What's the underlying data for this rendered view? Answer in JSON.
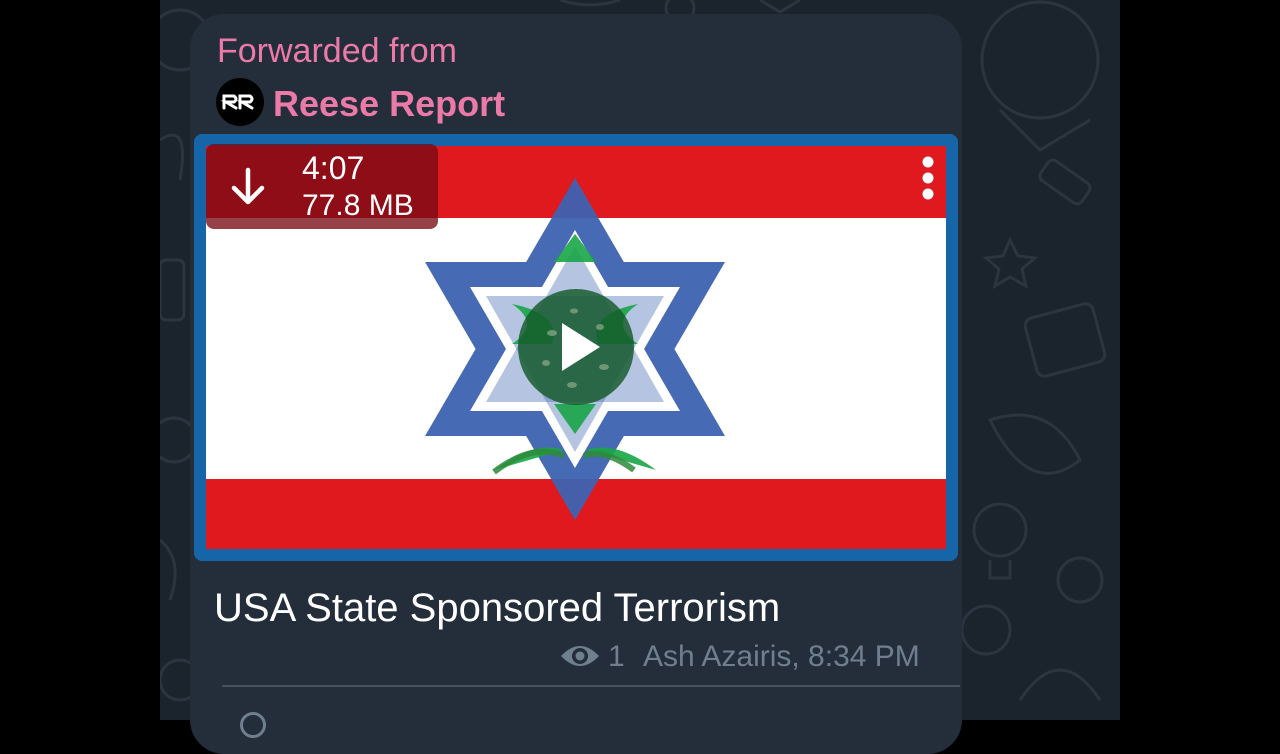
{
  "message": {
    "forwarded_label": "Forwarded from",
    "channel_name": "Reese Report",
    "avatar_initials": "RR",
    "video": {
      "duration": "4:07",
      "file_size": "77.8 MB",
      "download_icon": "arrow-down-icon",
      "menu_icon": "more-vertical-icon",
      "play_icon": "play-icon"
    },
    "caption": "USA State Sponsored Terrorism",
    "views": "1",
    "meta_text": "Ash Azairis, 8:34 PM",
    "eye_icon": "eye-icon"
  },
  "colors": {
    "forward_accent": "#ec7aa8",
    "bubble": "#242e3a",
    "chat_background": "#1b232c",
    "meta_text": "#6f7f8e",
    "media_border": "#1565a8"
  }
}
